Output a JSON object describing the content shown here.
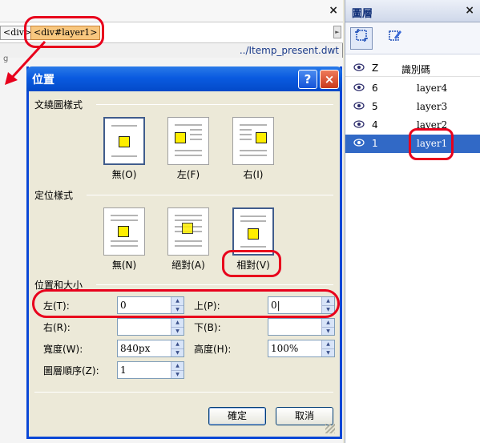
{
  "editor": {
    "close_glyph": "×",
    "tags": [
      "<div>",
      "<div#layer1>"
    ],
    "scroll_glyph": "►",
    "path": "../Itemp_present.dwt",
    "canvas_mark": "g"
  },
  "layers_panel": {
    "title": "圖層",
    "close_glyph": "×",
    "header": {
      "z": "Z",
      "name": "識別碼"
    },
    "rows": [
      {
        "z": "6",
        "name": "layer4"
      },
      {
        "z": "5",
        "name": "layer3"
      },
      {
        "z": "4",
        "name": "layer2"
      },
      {
        "z": "1",
        "name": "layer1"
      }
    ],
    "selected": "layer1"
  },
  "dialog": {
    "title": "位置",
    "help_glyph": "?",
    "close_glyph": "×",
    "wrap_group": {
      "label": "文繞圖樣式",
      "options": [
        "無(O)",
        "左(F)",
        "右(I)"
      ]
    },
    "position_group": {
      "label": "定位樣式",
      "options": [
        "無(N)",
        "絕對(A)",
        "相對(V)"
      ]
    },
    "size_group": {
      "label": "位置和大小",
      "left_label": "左(T):",
      "left_value": "0",
      "top_label": "上(P):",
      "top_value": "0|",
      "right_label": "右(R):",
      "right_value": "",
      "bottom_label": "下(B):",
      "bottom_value": "",
      "width_label": "寬度(W):",
      "width_value": "840px",
      "height_label": "高度(H):",
      "height_value": "100%",
      "zindex_label": "圖層順序(Z):",
      "zindex_value": "1"
    },
    "ok_label": "確定",
    "cancel_label": "取消"
  },
  "colors": {
    "titlebar": "#0a5be0",
    "selection": "#3169c6",
    "annotation": "#e8001c",
    "icon_fill": "#ffee00"
  }
}
